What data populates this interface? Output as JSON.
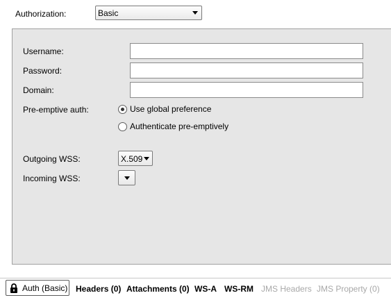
{
  "authorization": {
    "label": "Authorization:",
    "selected": "Basic"
  },
  "form": {
    "username_label": "Username:",
    "username_value": "",
    "password_label": "Password:",
    "password_value": "",
    "domain_label": "Domain:",
    "domain_value": "",
    "preemptive_label": "Pre-emptive auth:",
    "preemptive_options": [
      {
        "label": "Use global preference",
        "checked": true
      },
      {
        "label": "Authenticate pre-emptively",
        "checked": false
      }
    ],
    "outgoing_wss_label": "Outgoing WSS:",
    "outgoing_wss_value": "X.509",
    "incoming_wss_label": "Incoming WSS:",
    "incoming_wss_value": ""
  },
  "tabs": [
    {
      "label": "Auth (Basic)",
      "active": true,
      "icon": "lock-icon"
    },
    {
      "label": "Headers (0)"
    },
    {
      "label": "Attachments (0)"
    },
    {
      "label": "WS-A"
    },
    {
      "label": "WS-RM"
    },
    {
      "label": "JMS Headers",
      "disabled": true
    },
    {
      "label": "JMS Property (0)",
      "disabled": true
    }
  ]
}
